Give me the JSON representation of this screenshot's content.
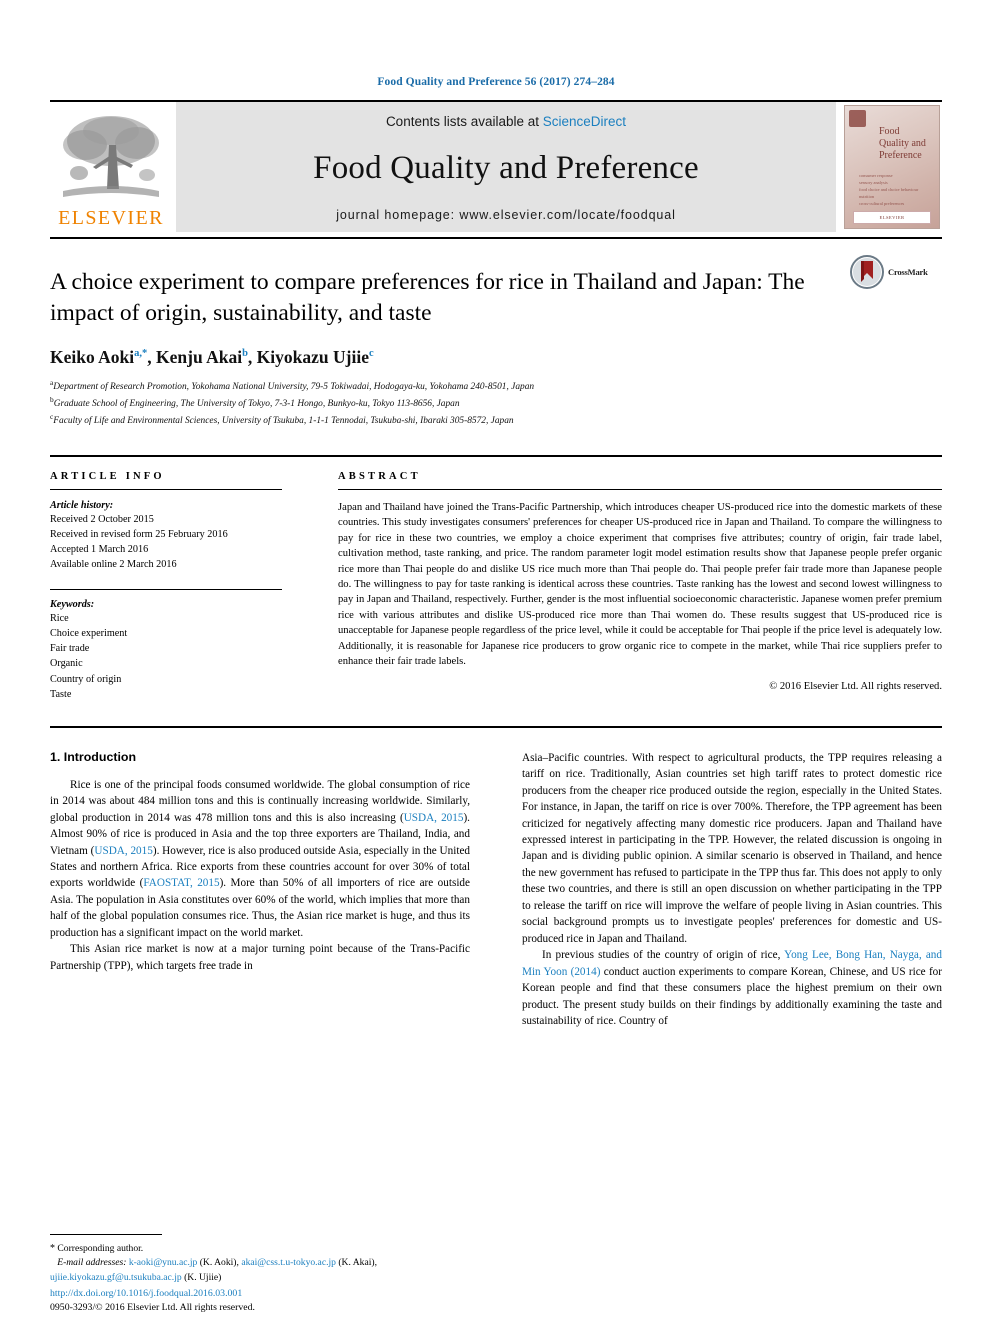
{
  "running_head": "Food Quality and Preference 56 (2017) 274–284",
  "masthead": {
    "publisher_logo_name": "elsevier-tree-logo",
    "publisher_wordmark": "ELSEVIER",
    "contents_prefix": "Contents lists available at ",
    "contents_link": "ScienceDirect",
    "journal_title": "Food Quality and Preference",
    "homepage": "journal homepage: www.elsevier.com/locate/foodqual",
    "cover": {
      "title_line1": "Food",
      "title_line2": "Quality and",
      "title_line3": "Preference",
      "bullets": [
        "consumer response",
        "sensory analysis",
        "food choice and choice behaviour",
        "nutrition",
        "cross-cultural preferences"
      ],
      "footer_label": "ELSEVIER"
    }
  },
  "title": "A choice experiment to compare preferences for rice in Thailand and Japan: The impact of origin, sustainability, and taste",
  "crossmark_label": "CrossMark",
  "authors": [
    {
      "name": "Keiko Aoki",
      "marks": "a,*"
    },
    {
      "name": "Kenju Akai",
      "marks": "b"
    },
    {
      "name": "Kiyokazu Ujiie",
      "marks": "c"
    }
  ],
  "affiliations": [
    {
      "mark": "a",
      "text": "Department of Research Promotion, Yokohama National University, 79-5 Tokiwadai, Hodogaya-ku, Yokohama 240-8501, Japan"
    },
    {
      "mark": "b",
      "text": "Graduate School of Engineering, The University of Tokyo, 7-3-1 Hongo, Bunkyo-ku, Tokyo 113-8656, Japan"
    },
    {
      "mark": "c",
      "text": "Faculty of Life and Environmental Sciences, University of Tsukuba, 1-1-1 Tennodai, Tsukuba-shi, Ibaraki 305-8572, Japan"
    }
  ],
  "article_info": {
    "heading": "ARTICLE INFO",
    "history_label": "Article history:",
    "history": [
      "Received 2 October 2015",
      "Received in revised form 25 February 2016",
      "Accepted 1 March 2016",
      "Available online 2 March 2016"
    ],
    "keywords_label": "Keywords:",
    "keywords": [
      "Rice",
      "Choice experiment",
      "Fair trade",
      "Organic",
      "Country of origin",
      "Taste"
    ]
  },
  "abstract": {
    "heading": "ABSTRACT",
    "text": "Japan and Thailand have joined the Trans-Pacific Partnership, which introduces cheaper US-produced rice into the domestic markets of these countries. This study investigates consumers' preferences for cheaper US-produced rice in Japan and Thailand. To compare the willingness to pay for rice in these two countries, we employ a choice experiment that comprises five attributes; country of origin, fair trade label, cultivation method, taste ranking, and price. The random parameter logit model estimation results show that Japanese people prefer organic rice more than Thai people do and dislike US rice much more than Thai people do. Thai people prefer fair trade more than Japanese people do. The willingness to pay for taste ranking is identical across these countries. Taste ranking has the lowest and second lowest willingness to pay in Japan and Thailand, respectively. Further, gender is the most influential socioeconomic characteristic. Japanese women prefer premium rice with various attributes and dislike US-produced rice more than Thai women do. These results suggest that US-produced rice is unacceptable for Japanese people regardless of the price level, while it could be acceptable for Thai people if the price level is adequately low. Additionally, it is reasonable for Japanese rice producers to grow organic rice to compete in the market, while Thai rice suppliers prefer to enhance their fair trade labels.",
    "copyright": "© 2016 Elsevier Ltd. All rights reserved."
  },
  "body": {
    "section_title": "1. Introduction",
    "left_column": {
      "p1_a": "Rice is one of the principal foods consumed worldwide. The global consumption of rice in 2014 was about 484 million tons and this is continually increasing worldwide. Similarly, global production in 2014 was 478 million tons and this is also increasing (",
      "p1_cite1": "USDA, 2015",
      "p1_b": "). Almost 90% of rice is produced in Asia and the top three exporters are Thailand, India, and Vietnam (",
      "p1_cite2": "USDA, 2015",
      "p1_c": "). However, rice is also produced outside Asia, especially in the United States and northern Africa. Rice exports from these countries account for over 30% of total exports worldwide (",
      "p1_cite3": "FAOSTAT, 2015",
      "p1_d": "). More than 50% of all importers of rice are outside Asia. The population in Asia constitutes over 60% of the world, which implies that more than half of the global population consumes rice. Thus, the Asian rice market is huge, and thus its production has a significant impact on the world market.",
      "p2": "This Asian rice market is now at a major turning point because of the Trans-Pacific Partnership (TPP), which targets free trade in"
    },
    "right_column": {
      "p2_cont": "Asia–Pacific countries. With respect to agricultural products, the TPP requires releasing a tariff on rice. Traditionally, Asian countries set high tariff rates to protect domestic rice producers from the cheaper rice produced outside the region, especially in the United States. For instance, in Japan, the tariff on rice is over 700%. Therefore, the TPP agreement has been criticized for negatively affecting many domestic rice producers. Japan and Thailand have expressed interest in participating in the TPP. However, the related discussion is ongoing in Japan and is dividing public opinion. A similar scenario is observed in Thailand, and hence the new government has refused to participate in the TPP thus far. This does not apply to only these two countries, and there is still an open discussion on whether participating in the TPP to release the tariff on rice will improve the welfare of people living in Asian countries. This social background prompts us to investigate peoples' preferences for domestic and US-produced rice in Japan and Thailand.",
      "p3_a": "In previous studies of the country of origin of rice, ",
      "p3_cite": "Yong Lee, Bong Han, Nayga, and Min Yoon (2014)",
      "p3_b": " conduct auction experiments to compare Korean, Chinese, and US rice for Korean people and find that these consumers place the highest premium on their own product. The present study builds on their findings by additionally examining the taste and sustainability of rice. Country of"
    }
  },
  "footnotes": {
    "corresponding": "Corresponding author.",
    "email_label": "E-mail addresses:",
    "emails": [
      {
        "address": "k-aoki@ynu.ac.jp",
        "owner": "(K. Aoki)"
      },
      {
        "address": "akai@css.t.u-tokyo.ac.jp",
        "owner": "(K. Akai)"
      },
      {
        "address": "ujiie.kiyokazu.gf@u.tsukuba.ac.jp",
        "owner": "(K. Ujiie)"
      }
    ]
  },
  "doi": "http://dx.doi.org/10.1016/j.foodqual.2016.03.001",
  "issn_line": "0950-3293/© 2016 Elsevier Ltd. All rights reserved.",
  "colors": {
    "link_blue": "#1b7fbf",
    "elsevier_orange": "#ef8200",
    "crossmark_red": "#a02020"
  }
}
